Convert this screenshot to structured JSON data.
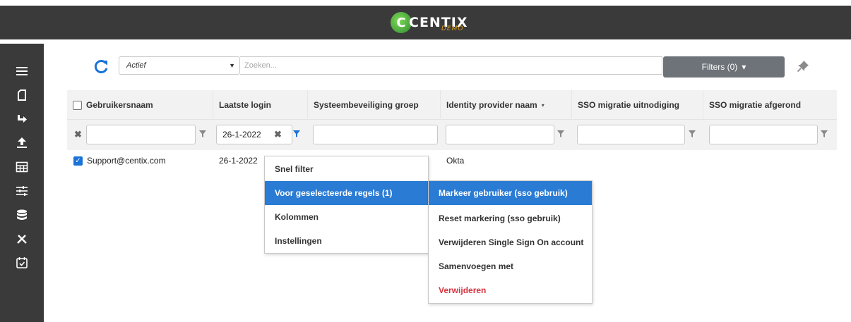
{
  "brand": {
    "name": "CENTIX",
    "sub": "DEMO",
    "mark": "C"
  },
  "sidebar": {
    "items": [
      {
        "icon": "menu-icon"
      },
      {
        "icon": "document-icon"
      },
      {
        "icon": "redirect-arrow-icon"
      },
      {
        "icon": "upload-icon"
      },
      {
        "icon": "table-icon"
      },
      {
        "icon": "sliders-icon"
      },
      {
        "icon": "database-icon"
      },
      {
        "icon": "tools-icon"
      },
      {
        "icon": "calendar-check-icon"
      }
    ]
  },
  "toolbar": {
    "status_value": "Actief",
    "search_placeholder": "Zoeken...",
    "filters_label": "Filters (0)",
    "filters_caret": "▾"
  },
  "table": {
    "columns": [
      "Gebruikersnaam",
      "Laatste login",
      "Systeembeveiliging groep",
      "Identity provider naam",
      "SSO migratie uitnodiging",
      "SSO migratie afgerond"
    ],
    "sort_column_caret": "▾",
    "filters": {
      "laatste_login": "26-1-2022"
    },
    "rows": [
      {
        "selected": true,
        "gebruikersnaam": "Support@centix.com",
        "laatste_login": "26-1-2022",
        "identity_provider": "Okta"
      }
    ]
  },
  "context_menu": {
    "items": [
      "Snel filter",
      "Voor geselecteerde regels (1)",
      "Kolommen",
      "Instellingen"
    ],
    "submenu": [
      "Markeer gebruiker (sso gebruik)",
      "Reset markering (sso gebruik)",
      "Verwijderen Single Sign On account",
      "Samenvoegen met",
      "Verwijderen"
    ]
  },
  "colors": {
    "accent": "#2a7bd4",
    "danger": "#d9333f",
    "topbar": "#3a3a3a",
    "filters_button": "#6d7378"
  }
}
